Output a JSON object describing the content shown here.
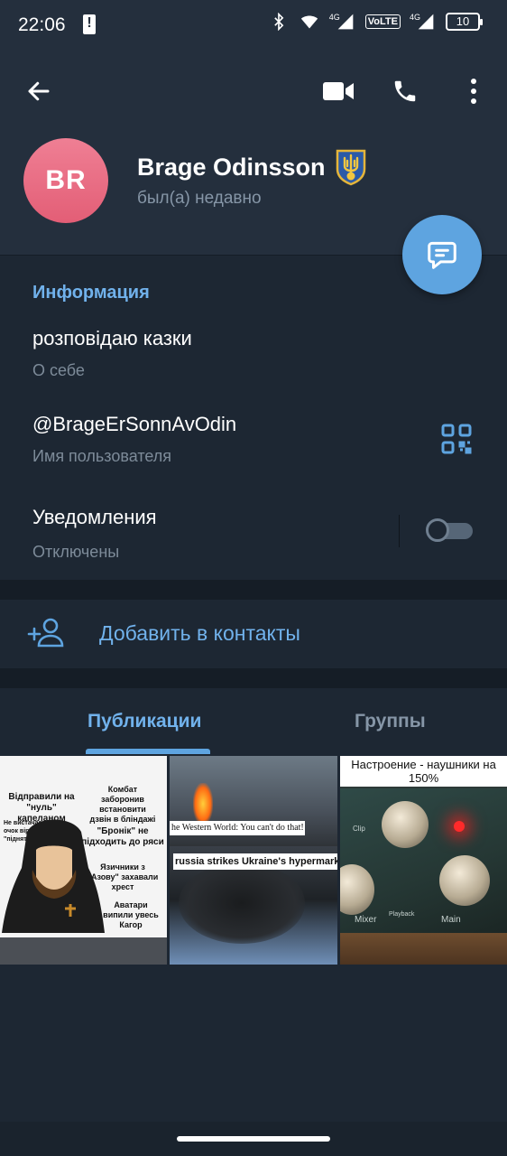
{
  "status_bar": {
    "time": "22:06",
    "network_label_1": "4G",
    "volte_label": "VoLTE",
    "network_label_2": "4G",
    "battery": "10"
  },
  "header": {
    "avatar_initials": "BR",
    "name": "Brage Odinsson",
    "status": "был(а) недавно",
    "badge_icon": "trident-shield-icon"
  },
  "info": {
    "section_title": "Информация",
    "bio": "розповідаю казки",
    "bio_label": "О себе",
    "username": "@BrageErSonnAvOdin",
    "username_label": "Имя пользователя",
    "notifications": "Уведомления",
    "notifications_state": "Отключены",
    "notifications_enabled": false
  },
  "actions": {
    "add_contact": "Добавить в контакты"
  },
  "tabs": [
    {
      "label": "Публикации",
      "active": true
    },
    {
      "label": "Группы",
      "active": false
    }
  ],
  "media": [
    {
      "texts": [
        "Відправили на \"нуль\" капеланом",
        "Комбат заборонив встановити дзвін в бліндажі",
        "Не вистачає очок віри для \"підняття\"",
        "\"Бронік\" не підходить до ряси",
        "Язичники з \"Азову\" захавали хрест",
        "Аватари випили увесь Кагор"
      ]
    },
    {
      "caption_top": "he Western World: You can't do that!",
      "caption_bottom": "russia strikes Ukraine's hypermarket"
    },
    {
      "caption": "Настроение - наушники на 150%",
      "panel_labels": [
        "Mixer",
        "Playback",
        "Main",
        "Clip"
      ]
    }
  ],
  "colors": {
    "header_bg": "#242f3d",
    "body_bg": "#1d2733",
    "accent": "#71b2ec",
    "fab": "#5ea4e0",
    "avatar": "#e35e76"
  }
}
